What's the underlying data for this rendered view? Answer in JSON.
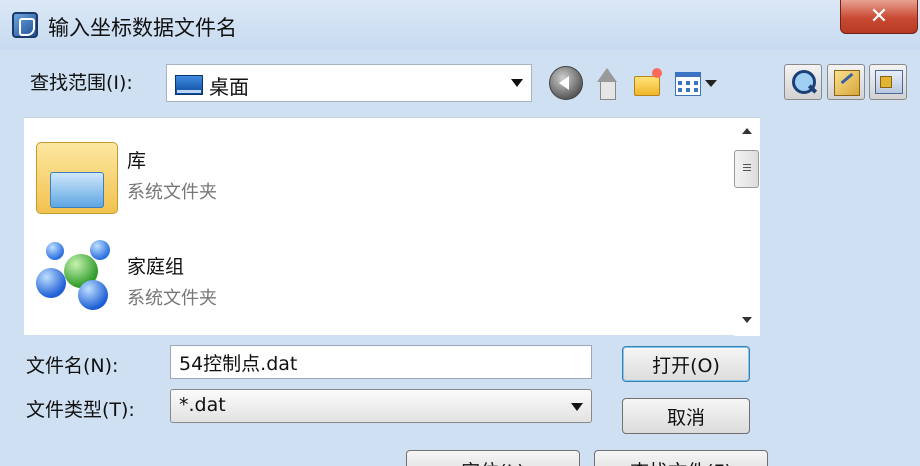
{
  "window": {
    "title": "输入坐标数据文件名",
    "close_label": "✕"
  },
  "toolbar": {
    "lookin_label": "查找范围(I):",
    "lookin_value": "桌面",
    "icons": [
      "back-icon",
      "up-folder-icon",
      "new-folder-icon",
      "views-menu-icon",
      "search-web-icon",
      "tools-icon",
      "network-icon"
    ]
  },
  "files": [
    {
      "name": "库",
      "type": "系统文件夹",
      "icon": "library-folder-icon"
    },
    {
      "name": "家庭组",
      "type": "系统文件夹",
      "icon": "homegroup-icon"
    }
  ],
  "form": {
    "filename_label": "文件名(N):",
    "filename_value": "54控制点.dat",
    "filetype_label": "文件类型(T):",
    "filetype_value": "*.dat"
  },
  "buttons": {
    "open": "打开(O)",
    "cancel": "取消",
    "locate": "定位(L)",
    "find": "查找文件(F)"
  },
  "colors": {
    "dialog_bg": "#cfe0f3",
    "close_button": "#c94a33"
  }
}
